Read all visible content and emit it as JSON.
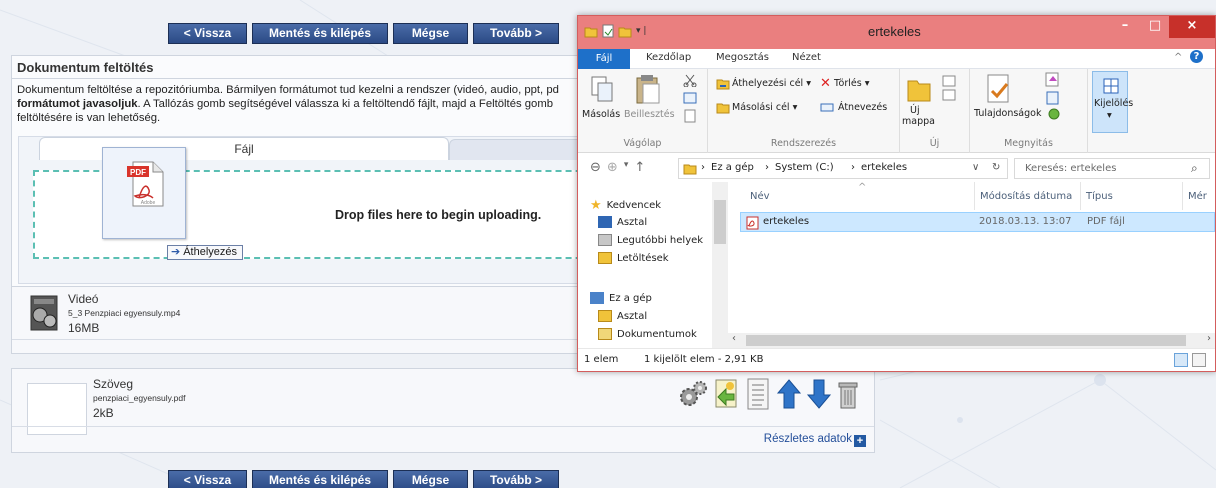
{
  "nav": {
    "back": "< Vissza",
    "save_exit": "Mentés és kilépés",
    "cancel": "Mégse",
    "next": "Tovább >"
  },
  "upload": {
    "title": "Dokumentum feltöltés",
    "desc_part1": "Dokumentum feltöltése a repozitóriumba. Bármilyen formátumot tud kezelni a rendszer (videó, audio, ppt, pd",
    "desc_bold": "formátumot javasoljuk",
    "desc_part2": ". A Tallózás gomb segítségével válassza ki a feltöltendő fájlt, majd a Feltöltés gomb",
    "desc_part3": "feltöltésére is van lehetőség.",
    "tab_file": "Fájl",
    "drop_text": "Drop files here to begin uploading.",
    "drag_tooltip": "Áthelyezés",
    "pdf_label": "PDF",
    "adobe_label": "Adobe"
  },
  "files": [
    {
      "type": "Videó",
      "name": "5_3 Penzpiaci egyensuly.mp4",
      "size": "16MB"
    },
    {
      "type": "Szöveg",
      "name": "penzpiaci_egyensuly.pdf",
      "size": "2kB"
    }
  ],
  "details_link": "Részletes adatok",
  "explorer": {
    "title": "ertekeles",
    "tabs": {
      "file": "Fájl",
      "home": "Kezdőlap",
      "share": "Megosztás",
      "view": "Nézet"
    },
    "ribbon": {
      "copy": "Másolás",
      "paste": "Beillesztés",
      "clipboard": "Vágólap",
      "move_to": "Áthelyezési cél ▾",
      "copy_to": "Másolási cél ▾",
      "delete": "Törlés ▾",
      "rename": "Átnevezés",
      "organize": "Rendszerezés",
      "new_folder_1": "Új",
      "new_folder_2": "mappa",
      "new": "Új",
      "properties": "Tulajdonságok",
      "open": "Megnyitás",
      "select": "Kijelölés"
    },
    "breadcrumb": [
      "Ez a gép",
      "System (C:)",
      "ertekeles"
    ],
    "search_placeholder": "Keresés: ertekeles",
    "nav": {
      "favorites": "Kedvencek",
      "desktop": "Asztal",
      "recent": "Legutóbbi helyek",
      "downloads": "Letöltések",
      "this_pc": "Ez a gép",
      "desktop2": "Asztal",
      "documents": "Dokumentumok"
    },
    "columns": {
      "name": "Név",
      "modified": "Módosítás dátuma",
      "type": "Típus",
      "size": "Mér"
    },
    "file": {
      "name": "ertekeles",
      "modified": "2018.03.13. 13:07",
      "type": "PDF fájl"
    },
    "status": {
      "items": "1 elem",
      "selected": "1 kijelölt elem - 2,91 KB"
    }
  }
}
